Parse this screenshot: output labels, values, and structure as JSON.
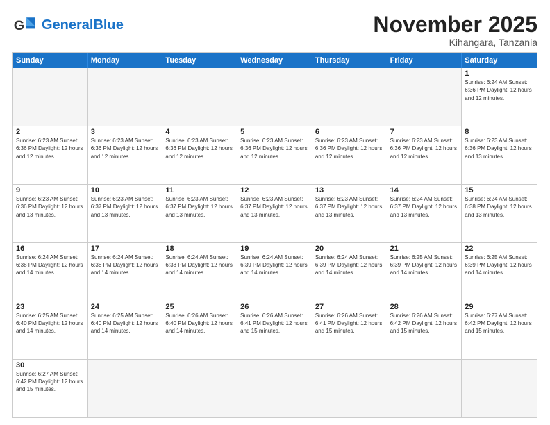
{
  "header": {
    "logo_general": "General",
    "logo_blue": "Blue",
    "month_title": "November 2025",
    "location": "Kihangara, Tanzania"
  },
  "days_of_week": [
    "Sunday",
    "Monday",
    "Tuesday",
    "Wednesday",
    "Thursday",
    "Friday",
    "Saturday"
  ],
  "weeks": [
    [
      {
        "day": "",
        "info": "",
        "empty": true
      },
      {
        "day": "",
        "info": "",
        "empty": true
      },
      {
        "day": "",
        "info": "",
        "empty": true
      },
      {
        "day": "",
        "info": "",
        "empty": true
      },
      {
        "day": "",
        "info": "",
        "empty": true
      },
      {
        "day": "",
        "info": "",
        "empty": true
      },
      {
        "day": "1",
        "info": "Sunrise: 6:24 AM\nSunset: 6:36 PM\nDaylight: 12 hours and 12 minutes.",
        "empty": false
      }
    ],
    [
      {
        "day": "2",
        "info": "Sunrise: 6:23 AM\nSunset: 6:36 PM\nDaylight: 12 hours and 12 minutes.",
        "empty": false
      },
      {
        "day": "3",
        "info": "Sunrise: 6:23 AM\nSunset: 6:36 PM\nDaylight: 12 hours and 12 minutes.",
        "empty": false
      },
      {
        "day": "4",
        "info": "Sunrise: 6:23 AM\nSunset: 6:36 PM\nDaylight: 12 hours and 12 minutes.",
        "empty": false
      },
      {
        "day": "5",
        "info": "Sunrise: 6:23 AM\nSunset: 6:36 PM\nDaylight: 12 hours and 12 minutes.",
        "empty": false
      },
      {
        "day": "6",
        "info": "Sunrise: 6:23 AM\nSunset: 6:36 PM\nDaylight: 12 hours and 12 minutes.",
        "empty": false
      },
      {
        "day": "7",
        "info": "Sunrise: 6:23 AM\nSunset: 6:36 PM\nDaylight: 12 hours and 12 minutes.",
        "empty": false
      },
      {
        "day": "8",
        "info": "Sunrise: 6:23 AM\nSunset: 6:36 PM\nDaylight: 12 hours and 13 minutes.",
        "empty": false
      }
    ],
    [
      {
        "day": "9",
        "info": "Sunrise: 6:23 AM\nSunset: 6:36 PM\nDaylight: 12 hours and 13 minutes.",
        "empty": false
      },
      {
        "day": "10",
        "info": "Sunrise: 6:23 AM\nSunset: 6:37 PM\nDaylight: 12 hours and 13 minutes.",
        "empty": false
      },
      {
        "day": "11",
        "info": "Sunrise: 6:23 AM\nSunset: 6:37 PM\nDaylight: 12 hours and 13 minutes.",
        "empty": false
      },
      {
        "day": "12",
        "info": "Sunrise: 6:23 AM\nSunset: 6:37 PM\nDaylight: 12 hours and 13 minutes.",
        "empty": false
      },
      {
        "day": "13",
        "info": "Sunrise: 6:23 AM\nSunset: 6:37 PM\nDaylight: 12 hours and 13 minutes.",
        "empty": false
      },
      {
        "day": "14",
        "info": "Sunrise: 6:24 AM\nSunset: 6:37 PM\nDaylight: 12 hours and 13 minutes.",
        "empty": false
      },
      {
        "day": "15",
        "info": "Sunrise: 6:24 AM\nSunset: 6:38 PM\nDaylight: 12 hours and 13 minutes.",
        "empty": false
      }
    ],
    [
      {
        "day": "16",
        "info": "Sunrise: 6:24 AM\nSunset: 6:38 PM\nDaylight: 12 hours and 14 minutes.",
        "empty": false
      },
      {
        "day": "17",
        "info": "Sunrise: 6:24 AM\nSunset: 6:38 PM\nDaylight: 12 hours and 14 minutes.",
        "empty": false
      },
      {
        "day": "18",
        "info": "Sunrise: 6:24 AM\nSunset: 6:38 PM\nDaylight: 12 hours and 14 minutes.",
        "empty": false
      },
      {
        "day": "19",
        "info": "Sunrise: 6:24 AM\nSunset: 6:39 PM\nDaylight: 12 hours and 14 minutes.",
        "empty": false
      },
      {
        "day": "20",
        "info": "Sunrise: 6:24 AM\nSunset: 6:39 PM\nDaylight: 12 hours and 14 minutes.",
        "empty": false
      },
      {
        "day": "21",
        "info": "Sunrise: 6:25 AM\nSunset: 6:39 PM\nDaylight: 12 hours and 14 minutes.",
        "empty": false
      },
      {
        "day": "22",
        "info": "Sunrise: 6:25 AM\nSunset: 6:39 PM\nDaylight: 12 hours and 14 minutes.",
        "empty": false
      }
    ],
    [
      {
        "day": "23",
        "info": "Sunrise: 6:25 AM\nSunset: 6:40 PM\nDaylight: 12 hours and 14 minutes.",
        "empty": false
      },
      {
        "day": "24",
        "info": "Sunrise: 6:25 AM\nSunset: 6:40 PM\nDaylight: 12 hours and 14 minutes.",
        "empty": false
      },
      {
        "day": "25",
        "info": "Sunrise: 6:26 AM\nSunset: 6:40 PM\nDaylight: 12 hours and 14 minutes.",
        "empty": false
      },
      {
        "day": "26",
        "info": "Sunrise: 6:26 AM\nSunset: 6:41 PM\nDaylight: 12 hours and 15 minutes.",
        "empty": false
      },
      {
        "day": "27",
        "info": "Sunrise: 6:26 AM\nSunset: 6:41 PM\nDaylight: 12 hours and 15 minutes.",
        "empty": false
      },
      {
        "day": "28",
        "info": "Sunrise: 6:26 AM\nSunset: 6:42 PM\nDaylight: 12 hours and 15 minutes.",
        "empty": false
      },
      {
        "day": "29",
        "info": "Sunrise: 6:27 AM\nSunset: 6:42 PM\nDaylight: 12 hours and 15 minutes.",
        "empty": false
      }
    ],
    [
      {
        "day": "30",
        "info": "Sunrise: 6:27 AM\nSunset: 6:42 PM\nDaylight: 12 hours and 15 minutes.",
        "empty": false
      },
      {
        "day": "",
        "info": "",
        "empty": true
      },
      {
        "day": "",
        "info": "",
        "empty": true
      },
      {
        "day": "",
        "info": "",
        "empty": true
      },
      {
        "day": "",
        "info": "",
        "empty": true
      },
      {
        "day": "",
        "info": "",
        "empty": true
      },
      {
        "day": "",
        "info": "",
        "empty": true
      }
    ]
  ]
}
